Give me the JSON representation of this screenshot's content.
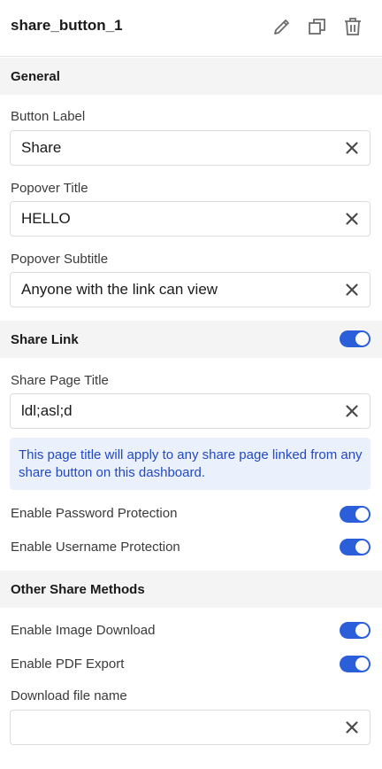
{
  "header": {
    "title": "share_button_1",
    "icons": [
      "pencil-icon",
      "duplicate-icon",
      "trash-icon"
    ]
  },
  "sections": {
    "general": "General",
    "share_link": "Share Link",
    "other": "Other Share Methods"
  },
  "fields": {
    "button_label": {
      "label": "Button Label",
      "value": "Share"
    },
    "popover_title": {
      "label": "Popover Title",
      "value": "HELLO"
    },
    "popover_subtitle": {
      "label": "Popover Subtitle",
      "value": "Anyone with the link can view"
    },
    "share_page_title": {
      "label": "Share Page Title",
      "value": "ldl;asl;d"
    },
    "download_file_name": {
      "label": "Download file name",
      "value": ""
    }
  },
  "info": {
    "text": "This page title will apply to any share page linked from any share button on this dashboard."
  },
  "toggles": {
    "share_link": {
      "on": true
    },
    "password": {
      "label": "Enable Password Protection",
      "on": true
    },
    "username": {
      "label": "Enable Username Protection",
      "on": true
    },
    "image_download": {
      "label": "Enable Image Download",
      "on": true
    },
    "pdf_export": {
      "label": "Enable PDF Export",
      "on": true
    }
  },
  "colors": {
    "accent": "#2b5fd9",
    "info_bg": "#eaf1fd",
    "info_text": "#2248c4",
    "section_bg": "#f4f4f5"
  }
}
